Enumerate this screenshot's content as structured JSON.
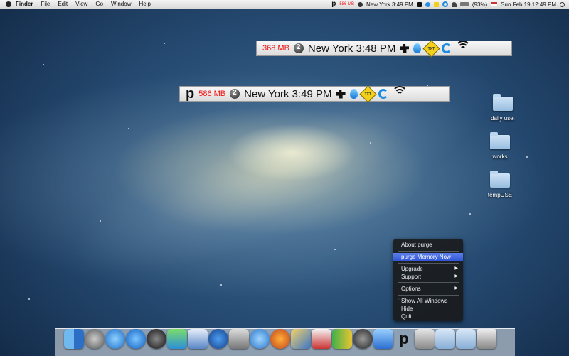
{
  "menubar": {
    "app_name": "Finder",
    "menus": [
      "File",
      "Edit",
      "View",
      "Go",
      "Window",
      "Help"
    ],
    "status": {
      "purge_letter": "p",
      "memory": "586 MB",
      "clock_city": "New York 3:49 PM",
      "battery": "(93%)",
      "datetime": "Sun Feb 19  12:49 PM"
    }
  },
  "bar_top": {
    "memory": "368 MB",
    "clock_city": "New York 3:48 PM",
    "txt_icon": "TXT"
  },
  "bar_bottom": {
    "purge_letter": "p",
    "memory": "586 MB",
    "clock_city": "New York 3:49 PM",
    "txt_icon": "TXT"
  },
  "desktop_folders": [
    "daily use.",
    "works",
    "tempUSE"
  ],
  "context_menu": {
    "about": "About purge",
    "purge_now": "purge Memory Now",
    "upgrade": "Upgrade",
    "support": "Support",
    "options": "Options",
    "show_all": "Show All Windows",
    "hide": "Hide",
    "quit": "Quit",
    "submenu_arrow": "▶"
  },
  "dock": {
    "items": [
      "finder-icon",
      "rocket-icon",
      "itunes-icon",
      "app-store-icon",
      "dvd-icon",
      "messenger-icon",
      "mail-icon",
      "google-earth-icon",
      "photo-booth-icon",
      "safari-icon",
      "firefox-icon",
      "pencil-icon",
      "preview-icon",
      "chart-icon",
      "zone-icon",
      "xcode-icon",
      "purge-icon",
      "scissors-icon",
      "applications-folder-icon",
      "downloads-folder-icon",
      "trash-icon"
    ],
    "purge_letter": "p"
  }
}
